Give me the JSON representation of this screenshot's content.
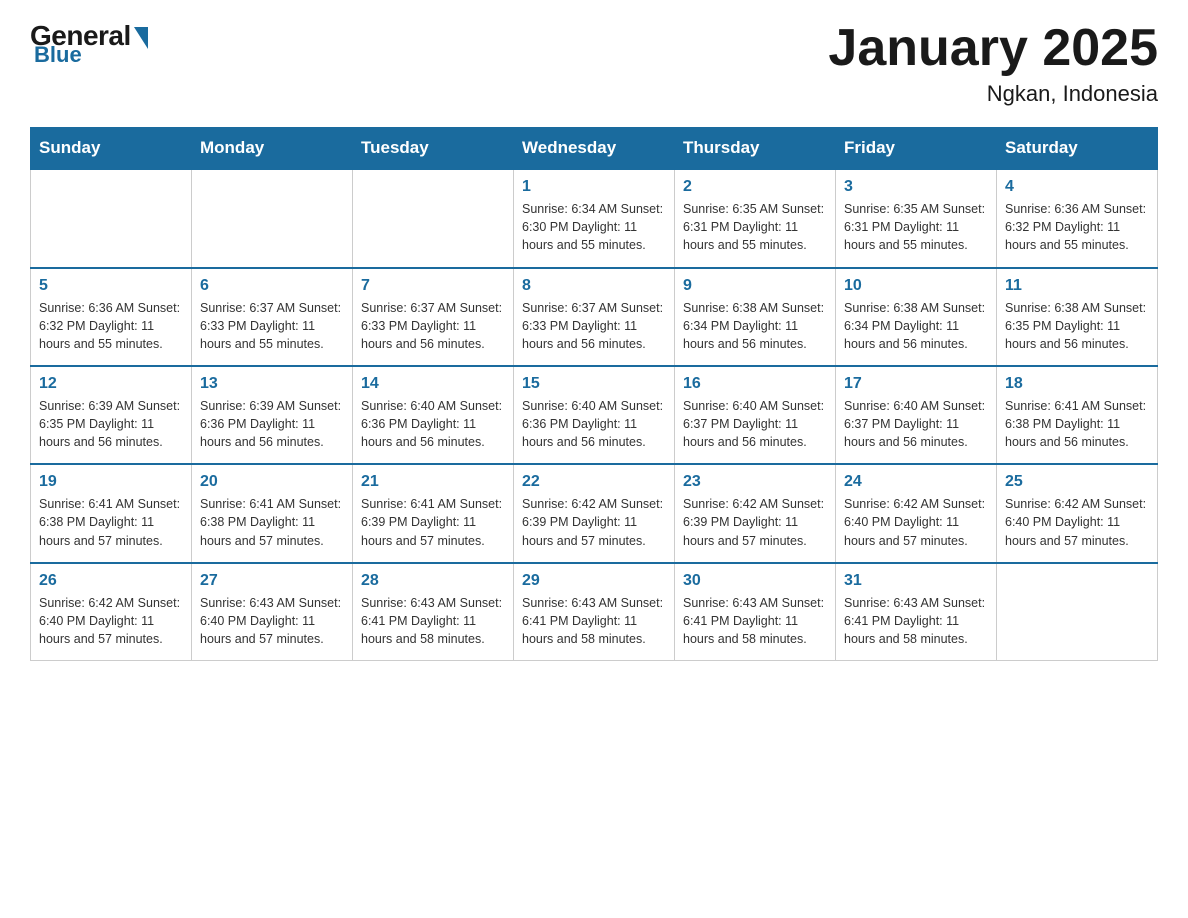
{
  "header": {
    "logo_general": "General",
    "logo_blue": "Blue",
    "month_title": "January 2025",
    "location": "Ngkan, Indonesia"
  },
  "days_of_week": [
    "Sunday",
    "Monday",
    "Tuesday",
    "Wednesday",
    "Thursday",
    "Friday",
    "Saturday"
  ],
  "weeks": [
    [
      {
        "day": "",
        "info": ""
      },
      {
        "day": "",
        "info": ""
      },
      {
        "day": "",
        "info": ""
      },
      {
        "day": "1",
        "info": "Sunrise: 6:34 AM\nSunset: 6:30 PM\nDaylight: 11 hours and 55 minutes."
      },
      {
        "day": "2",
        "info": "Sunrise: 6:35 AM\nSunset: 6:31 PM\nDaylight: 11 hours and 55 minutes."
      },
      {
        "day": "3",
        "info": "Sunrise: 6:35 AM\nSunset: 6:31 PM\nDaylight: 11 hours and 55 minutes."
      },
      {
        "day": "4",
        "info": "Sunrise: 6:36 AM\nSunset: 6:32 PM\nDaylight: 11 hours and 55 minutes."
      }
    ],
    [
      {
        "day": "5",
        "info": "Sunrise: 6:36 AM\nSunset: 6:32 PM\nDaylight: 11 hours and 55 minutes."
      },
      {
        "day": "6",
        "info": "Sunrise: 6:37 AM\nSunset: 6:33 PM\nDaylight: 11 hours and 55 minutes."
      },
      {
        "day": "7",
        "info": "Sunrise: 6:37 AM\nSunset: 6:33 PM\nDaylight: 11 hours and 56 minutes."
      },
      {
        "day": "8",
        "info": "Sunrise: 6:37 AM\nSunset: 6:33 PM\nDaylight: 11 hours and 56 minutes."
      },
      {
        "day": "9",
        "info": "Sunrise: 6:38 AM\nSunset: 6:34 PM\nDaylight: 11 hours and 56 minutes."
      },
      {
        "day": "10",
        "info": "Sunrise: 6:38 AM\nSunset: 6:34 PM\nDaylight: 11 hours and 56 minutes."
      },
      {
        "day": "11",
        "info": "Sunrise: 6:38 AM\nSunset: 6:35 PM\nDaylight: 11 hours and 56 minutes."
      }
    ],
    [
      {
        "day": "12",
        "info": "Sunrise: 6:39 AM\nSunset: 6:35 PM\nDaylight: 11 hours and 56 minutes."
      },
      {
        "day": "13",
        "info": "Sunrise: 6:39 AM\nSunset: 6:36 PM\nDaylight: 11 hours and 56 minutes."
      },
      {
        "day": "14",
        "info": "Sunrise: 6:40 AM\nSunset: 6:36 PM\nDaylight: 11 hours and 56 minutes."
      },
      {
        "day": "15",
        "info": "Sunrise: 6:40 AM\nSunset: 6:36 PM\nDaylight: 11 hours and 56 minutes."
      },
      {
        "day": "16",
        "info": "Sunrise: 6:40 AM\nSunset: 6:37 PM\nDaylight: 11 hours and 56 minutes."
      },
      {
        "day": "17",
        "info": "Sunrise: 6:40 AM\nSunset: 6:37 PM\nDaylight: 11 hours and 56 minutes."
      },
      {
        "day": "18",
        "info": "Sunrise: 6:41 AM\nSunset: 6:38 PM\nDaylight: 11 hours and 56 minutes."
      }
    ],
    [
      {
        "day": "19",
        "info": "Sunrise: 6:41 AM\nSunset: 6:38 PM\nDaylight: 11 hours and 57 minutes."
      },
      {
        "day": "20",
        "info": "Sunrise: 6:41 AM\nSunset: 6:38 PM\nDaylight: 11 hours and 57 minutes."
      },
      {
        "day": "21",
        "info": "Sunrise: 6:41 AM\nSunset: 6:39 PM\nDaylight: 11 hours and 57 minutes."
      },
      {
        "day": "22",
        "info": "Sunrise: 6:42 AM\nSunset: 6:39 PM\nDaylight: 11 hours and 57 minutes."
      },
      {
        "day": "23",
        "info": "Sunrise: 6:42 AM\nSunset: 6:39 PM\nDaylight: 11 hours and 57 minutes."
      },
      {
        "day": "24",
        "info": "Sunrise: 6:42 AM\nSunset: 6:40 PM\nDaylight: 11 hours and 57 minutes."
      },
      {
        "day": "25",
        "info": "Sunrise: 6:42 AM\nSunset: 6:40 PM\nDaylight: 11 hours and 57 minutes."
      }
    ],
    [
      {
        "day": "26",
        "info": "Sunrise: 6:42 AM\nSunset: 6:40 PM\nDaylight: 11 hours and 57 minutes."
      },
      {
        "day": "27",
        "info": "Sunrise: 6:43 AM\nSunset: 6:40 PM\nDaylight: 11 hours and 57 minutes."
      },
      {
        "day": "28",
        "info": "Sunrise: 6:43 AM\nSunset: 6:41 PM\nDaylight: 11 hours and 58 minutes."
      },
      {
        "day": "29",
        "info": "Sunrise: 6:43 AM\nSunset: 6:41 PM\nDaylight: 11 hours and 58 minutes."
      },
      {
        "day": "30",
        "info": "Sunrise: 6:43 AM\nSunset: 6:41 PM\nDaylight: 11 hours and 58 minutes."
      },
      {
        "day": "31",
        "info": "Sunrise: 6:43 AM\nSunset: 6:41 PM\nDaylight: 11 hours and 58 minutes."
      },
      {
        "day": "",
        "info": ""
      }
    ]
  ]
}
